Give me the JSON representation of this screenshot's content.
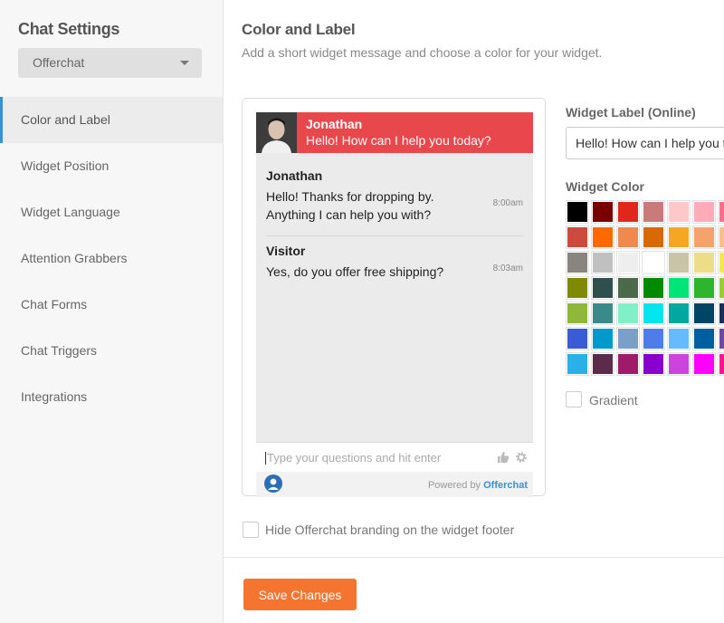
{
  "sidebar": {
    "title": "Chat Settings",
    "account_select": "Offerchat",
    "items": [
      {
        "label": "Color and Label"
      },
      {
        "label": "Widget Position"
      },
      {
        "label": "Widget Language"
      },
      {
        "label": "Attention Grabbers"
      },
      {
        "label": "Chat Forms"
      },
      {
        "label": "Chat Triggers"
      },
      {
        "label": "Integrations"
      }
    ]
  },
  "main": {
    "title": "Color and Label",
    "subtitle": "Add a short widget message and choose a color for your widget."
  },
  "widget": {
    "agent_name": "Jonathan",
    "greeting": "Hello! How can I help you today?",
    "header_color": "#e8474c",
    "messages": [
      {
        "sender": "Jonathan",
        "text": "Hello! Thanks for dropping by. Anything I can help you with?",
        "time": "8:00am"
      },
      {
        "sender": "Visitor",
        "text": "Yes, do you offer free shipping?",
        "time": "8:03am"
      }
    ],
    "input_placeholder": "Type your questions and hit enter",
    "powered_by": "Powered by",
    "brand": "Offerchat"
  },
  "settings": {
    "label_title": "Widget Label (Online)",
    "label_value": "Hello! How can I help you today?",
    "color_title": "Widget Color",
    "gradient_label": "Gradient",
    "hide_branding_label": "Hide Offerchat branding on the widget footer",
    "save_label": "Save Changes"
  },
  "palette": [
    [
      "#000000",
      "#7a0000",
      "#e1261c",
      "#c97b7b",
      "#ffc8c8",
      "#ffabb8",
      "#ff6b8a"
    ],
    [
      "#cc4b3c",
      "#ff6a00",
      "#f0894d",
      "#d66a00",
      "#f5a623",
      "#f5a36a",
      "#f7c08a"
    ],
    [
      "#8a8480",
      "#c0c0c0",
      "#eeeeee",
      "#ffffff",
      "#c9c4a8",
      "#eedd88",
      "#f5e94a"
    ],
    [
      "#808a00",
      "#2f4f4f",
      "#4a6a4a",
      "#008a00",
      "#00e676",
      "#2db52d",
      "#9acd32"
    ],
    [
      "#8fb83a",
      "#3a8a8a",
      "#80f0c8",
      "#00e5ee",
      "#00a8a0",
      "#004466",
      "#1a2f5a"
    ],
    [
      "#3b5bd6",
      "#0099cc",
      "#7aa0c8",
      "#4d7de8",
      "#66bbff",
      "#005fa0",
      "#6a4aa0"
    ],
    [
      "#2ab0e8",
      "#5c2a4a",
      "#a01a6a",
      "#8800cc",
      "#cc44dd",
      "#ff00ff",
      "#ff1493"
    ]
  ],
  "colors": {
    "accent": "#3a8fd6",
    "save_button": "#f47430"
  }
}
